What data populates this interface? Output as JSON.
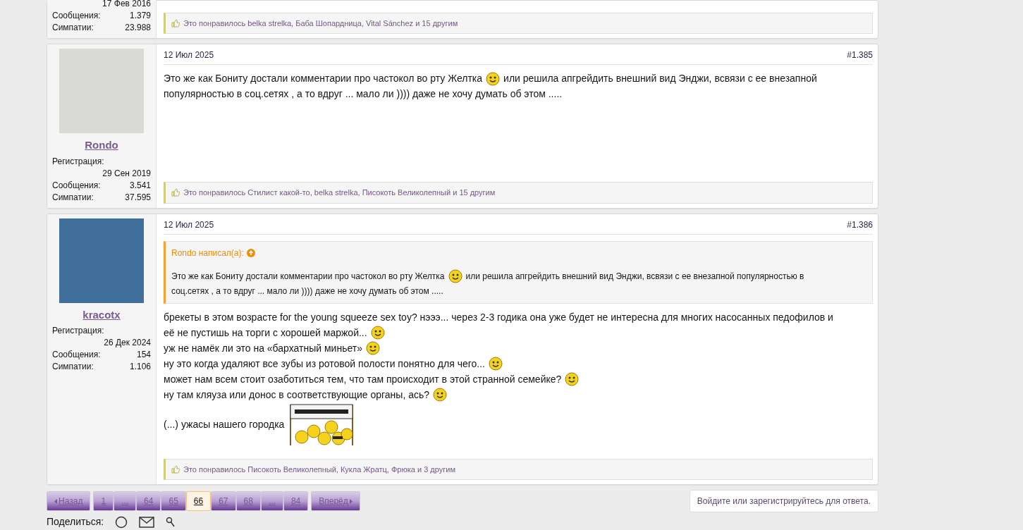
{
  "posts": [
    {
      "author": {
        "avatar": false,
        "registered_value": "17 Фев 2016",
        "stats": [
          {
            "label": "Сообщения:",
            "value": "1.379"
          },
          {
            "label": "Симпатии:",
            "value": "23.988"
          }
        ]
      },
      "likes": "Это понравилось belka strelka, Баба Шопардница, Vital Sánchez и 15 другим"
    },
    {
      "author": {
        "avatar": true,
        "name": "Rondo",
        "registered_label": "Регистрация:",
        "registered_value": "29 Сен 2019",
        "stats": [
          {
            "label": "Сообщения:",
            "value": "3.541"
          },
          {
            "label": "Симпатии:",
            "value": "37.595"
          }
        ]
      },
      "date": "12 Июл 2025",
      "number": "#1.385",
      "body": [
        [
          {
            "kind": "text",
            "text": "Это же как Бониту достали комментарии про частокол во рту Желтка"
          },
          {
            "kind": "smiley"
          },
          {
            "kind": "text",
            "text": "или решила апгрейдить внешний вид Энджи, всвязи с ее внезапной"
          }
        ],
        [
          {
            "kind": "text",
            "text": "популярностью в соц.сетях , а то вдруг ... мало ли )))) даже не хочу думать об этом ....."
          }
        ]
      ],
      "likes": "Это понравилось Стилист какой-то, belka strelka, Писокоть Великолепный и 15 другим"
    },
    {
      "author": {
        "avatar": true,
        "name": "kracotx",
        "registered_label": "Регистрация:",
        "registered_value": "26 Дек 2024",
        "stats": [
          {
            "label": "Сообщения:",
            "value": "154"
          },
          {
            "label": "Симпатии:",
            "value": "1.106"
          }
        ]
      },
      "date": "12 Июл 2025",
      "number": "#1.386",
      "quote": {
        "author": "Rondo написал(а):",
        "lines": [
          [
            {
              "kind": "text",
              "text": "Это же как Бониту достали комментарии про частокол во рту Желтка"
            },
            {
              "kind": "smiley"
            },
            {
              "kind": "text",
              "text": "или решила апгрейдить внешний вид Энджи, всвязи с ее внезапной популярностью в"
            }
          ],
          [
            {
              "kind": "text",
              "text": "соц.сетях , а то вдруг ... мало ли )))) даже не хочу думать об этом ....."
            }
          ]
        ]
      },
      "body": [
        [
          {
            "kind": "text",
            "text": "брекеты в этом возрасте for the young squeeze sex toy? нэээ... через 2-3 годика она уже будет не интересна для многих насосанных педофилов и"
          }
        ],
        [
          {
            "kind": "text",
            "text": "её не пустишь на торги с хорошей маржой..."
          },
          {
            "kind": "smiley"
          }
        ],
        [
          {
            "kind": "text",
            "text": "уж не намёк ли это на «бархатный миньет» "
          },
          {
            "kind": "smiley"
          }
        ],
        [
          {
            "kind": "text",
            "text": "ну это когда удаляют все зубы из ротовой полости понятно для чего... "
          },
          {
            "kind": "smiley"
          }
        ],
        [
          {
            "kind": "text",
            "text": "может нам всем стоит озаботиться тем, что там происходит в этой странной семейке? "
          },
          {
            "kind": "smiley"
          }
        ],
        [
          {
            "kind": "text",
            "text": "ну там кляуза или донос в соответствующие органы, ась? "
          },
          {
            "kind": "smiley"
          }
        ],
        [
          {
            "kind": "text",
            "text": "(...) ужасы нашего городка "
          },
          {
            "kind": "welcome-sign"
          }
        ]
      ],
      "likes": "Это понравилось Писокоть Великолепный, Кукла Жратц, Фрюка и 3 другим"
    }
  ],
  "pagination": {
    "prev": "Назад",
    "pages": [
      {
        "label": "1",
        "selected": false
      },
      {
        "label": "...",
        "selected": false
      },
      {
        "label": "64",
        "selected": false
      },
      {
        "label": "65",
        "selected": false
      },
      {
        "label": "66",
        "selected": true
      },
      {
        "label": "67",
        "selected": false
      },
      {
        "label": "68",
        "selected": false
      },
      {
        "label": "...",
        "selected": false
      },
      {
        "label": "84",
        "selected": false
      }
    ],
    "next": "Вперёд"
  },
  "reply_button": "Войдите или зарегистрируйтесь для ответа.",
  "share": {
    "label": "Поделиться:"
  }
}
